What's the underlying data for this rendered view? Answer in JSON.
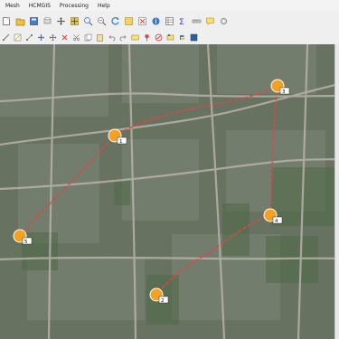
{
  "menubar": {
    "items": [
      "Mesh",
      "HCMGIS",
      "Processing",
      "Help"
    ]
  },
  "toolbar": {
    "row1": [
      "new-project-icon",
      "open-project-icon",
      "save-project-icon",
      "print-layout-icon",
      "pan-icon",
      "pan-to-selection-icon",
      "zoom-in-icon",
      "zoom-out-icon",
      "refresh-icon",
      "select-features-icon",
      "deselect-icon",
      "identify-icon",
      "open-attribute-table-icon",
      "statistics-icon",
      "measure-icon",
      "annotation-icon",
      "settings-icon"
    ],
    "row2": [
      "digitize-icon",
      "edit-layer-icon",
      "node-tool-icon",
      "add-feature-icon",
      "move-feature-icon",
      "delete-feature-icon",
      "cut-icon",
      "copy-icon",
      "paste-icon",
      "undo-icon",
      "redo-icon",
      "label-icon",
      "pin-icon",
      "route-icon",
      "plugin-icon",
      "python-icon",
      "help-icon"
    ]
  },
  "map": {
    "markers": [
      {
        "label": "1"
      },
      {
        "label": "3"
      },
      {
        "label": "4"
      },
      {
        "label": "5"
      },
      {
        "label": "2"
      }
    ],
    "colors": {
      "marker": "#f4a020",
      "marker_outline": "#ffffff",
      "route": "#d64a4a"
    }
  }
}
